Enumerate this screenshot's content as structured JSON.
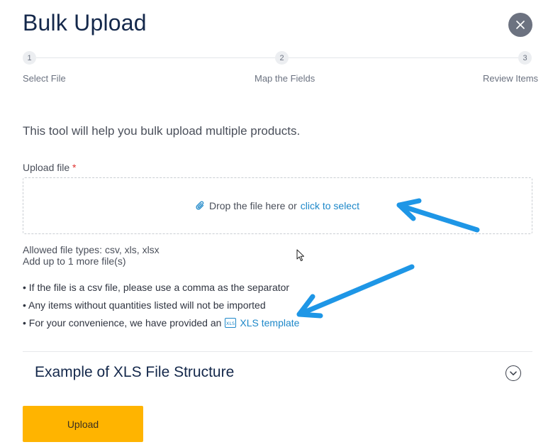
{
  "header": {
    "title": "Bulk Upload",
    "close_icon": "close-icon"
  },
  "stepper": {
    "steps": [
      {
        "number": "1",
        "label": "Select File"
      },
      {
        "number": "2",
        "label": "Map the Fields"
      },
      {
        "number": "3",
        "label": "Review Items"
      }
    ]
  },
  "intro": "This tool will help you bulk upload multiple products.",
  "upload": {
    "label": "Upload file",
    "required_mark": "*",
    "drop_text": "Drop the file here or",
    "click_text": "click to select",
    "icon": "paperclip-icon"
  },
  "allowed": {
    "types": "Allowed file types: csv, xls, xlsx",
    "limit": "Add up to 1 more file(s)"
  },
  "rules": {
    "csv": "• If the file is a csv file, please use a comma as the separator",
    "quantities": "• Any items without quantities listed will not be imported",
    "template_prefix": "• For your convenience, we have provided an",
    "template_link": "XLS template",
    "template_icon": "xls-file-icon"
  },
  "example": {
    "title": "Example of XLS File Structure",
    "toggle_icon": "chevron-down-icon"
  },
  "actions": {
    "upload_label": "Upload"
  },
  "colors": {
    "accent": "#1e88c9",
    "button": "#ffb400",
    "title": "#14284b",
    "annotation": "#1e96e6"
  }
}
